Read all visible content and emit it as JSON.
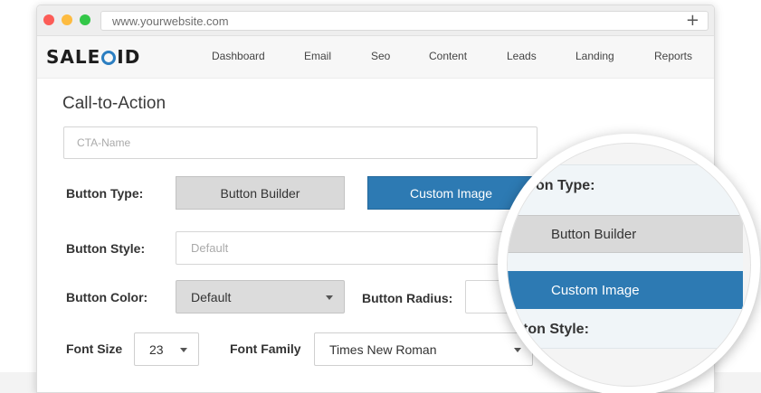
{
  "browser": {
    "url": "www.yourwebsite.com",
    "new_tab_icon": "plus-icon"
  },
  "navbar": {
    "logo": "SALEOID",
    "items": [
      "Dashboard",
      "Email",
      "Seo",
      "Content",
      "Leads",
      "Landing",
      "Reports"
    ]
  },
  "form": {
    "title": "Call-to-Action",
    "cta_name_placeholder": "CTA-Name",
    "button_type_label": "Button Type:",
    "button_builder_label": "Button Builder",
    "custom_image_label": "Custom Image",
    "button_style_label": "Button Style:",
    "button_style_placeholder": "Default",
    "button_color_label": "Button Color:",
    "button_color_value": "Default",
    "button_radius_label": "Button Radius:",
    "font_size_label": "Font Size",
    "font_size_value": "23",
    "font_family_label": "Font Family",
    "font_family_value": "Times New Roman"
  },
  "magnifier": {
    "button_type_label": "on Type:",
    "button_builder_label": "Button Builder",
    "custom_image_label": "Custom Image",
    "button_style_label": "ton Style:"
  },
  "colors": {
    "accent": "#2d7ab3",
    "logo_ring": "#2b7ec1"
  }
}
